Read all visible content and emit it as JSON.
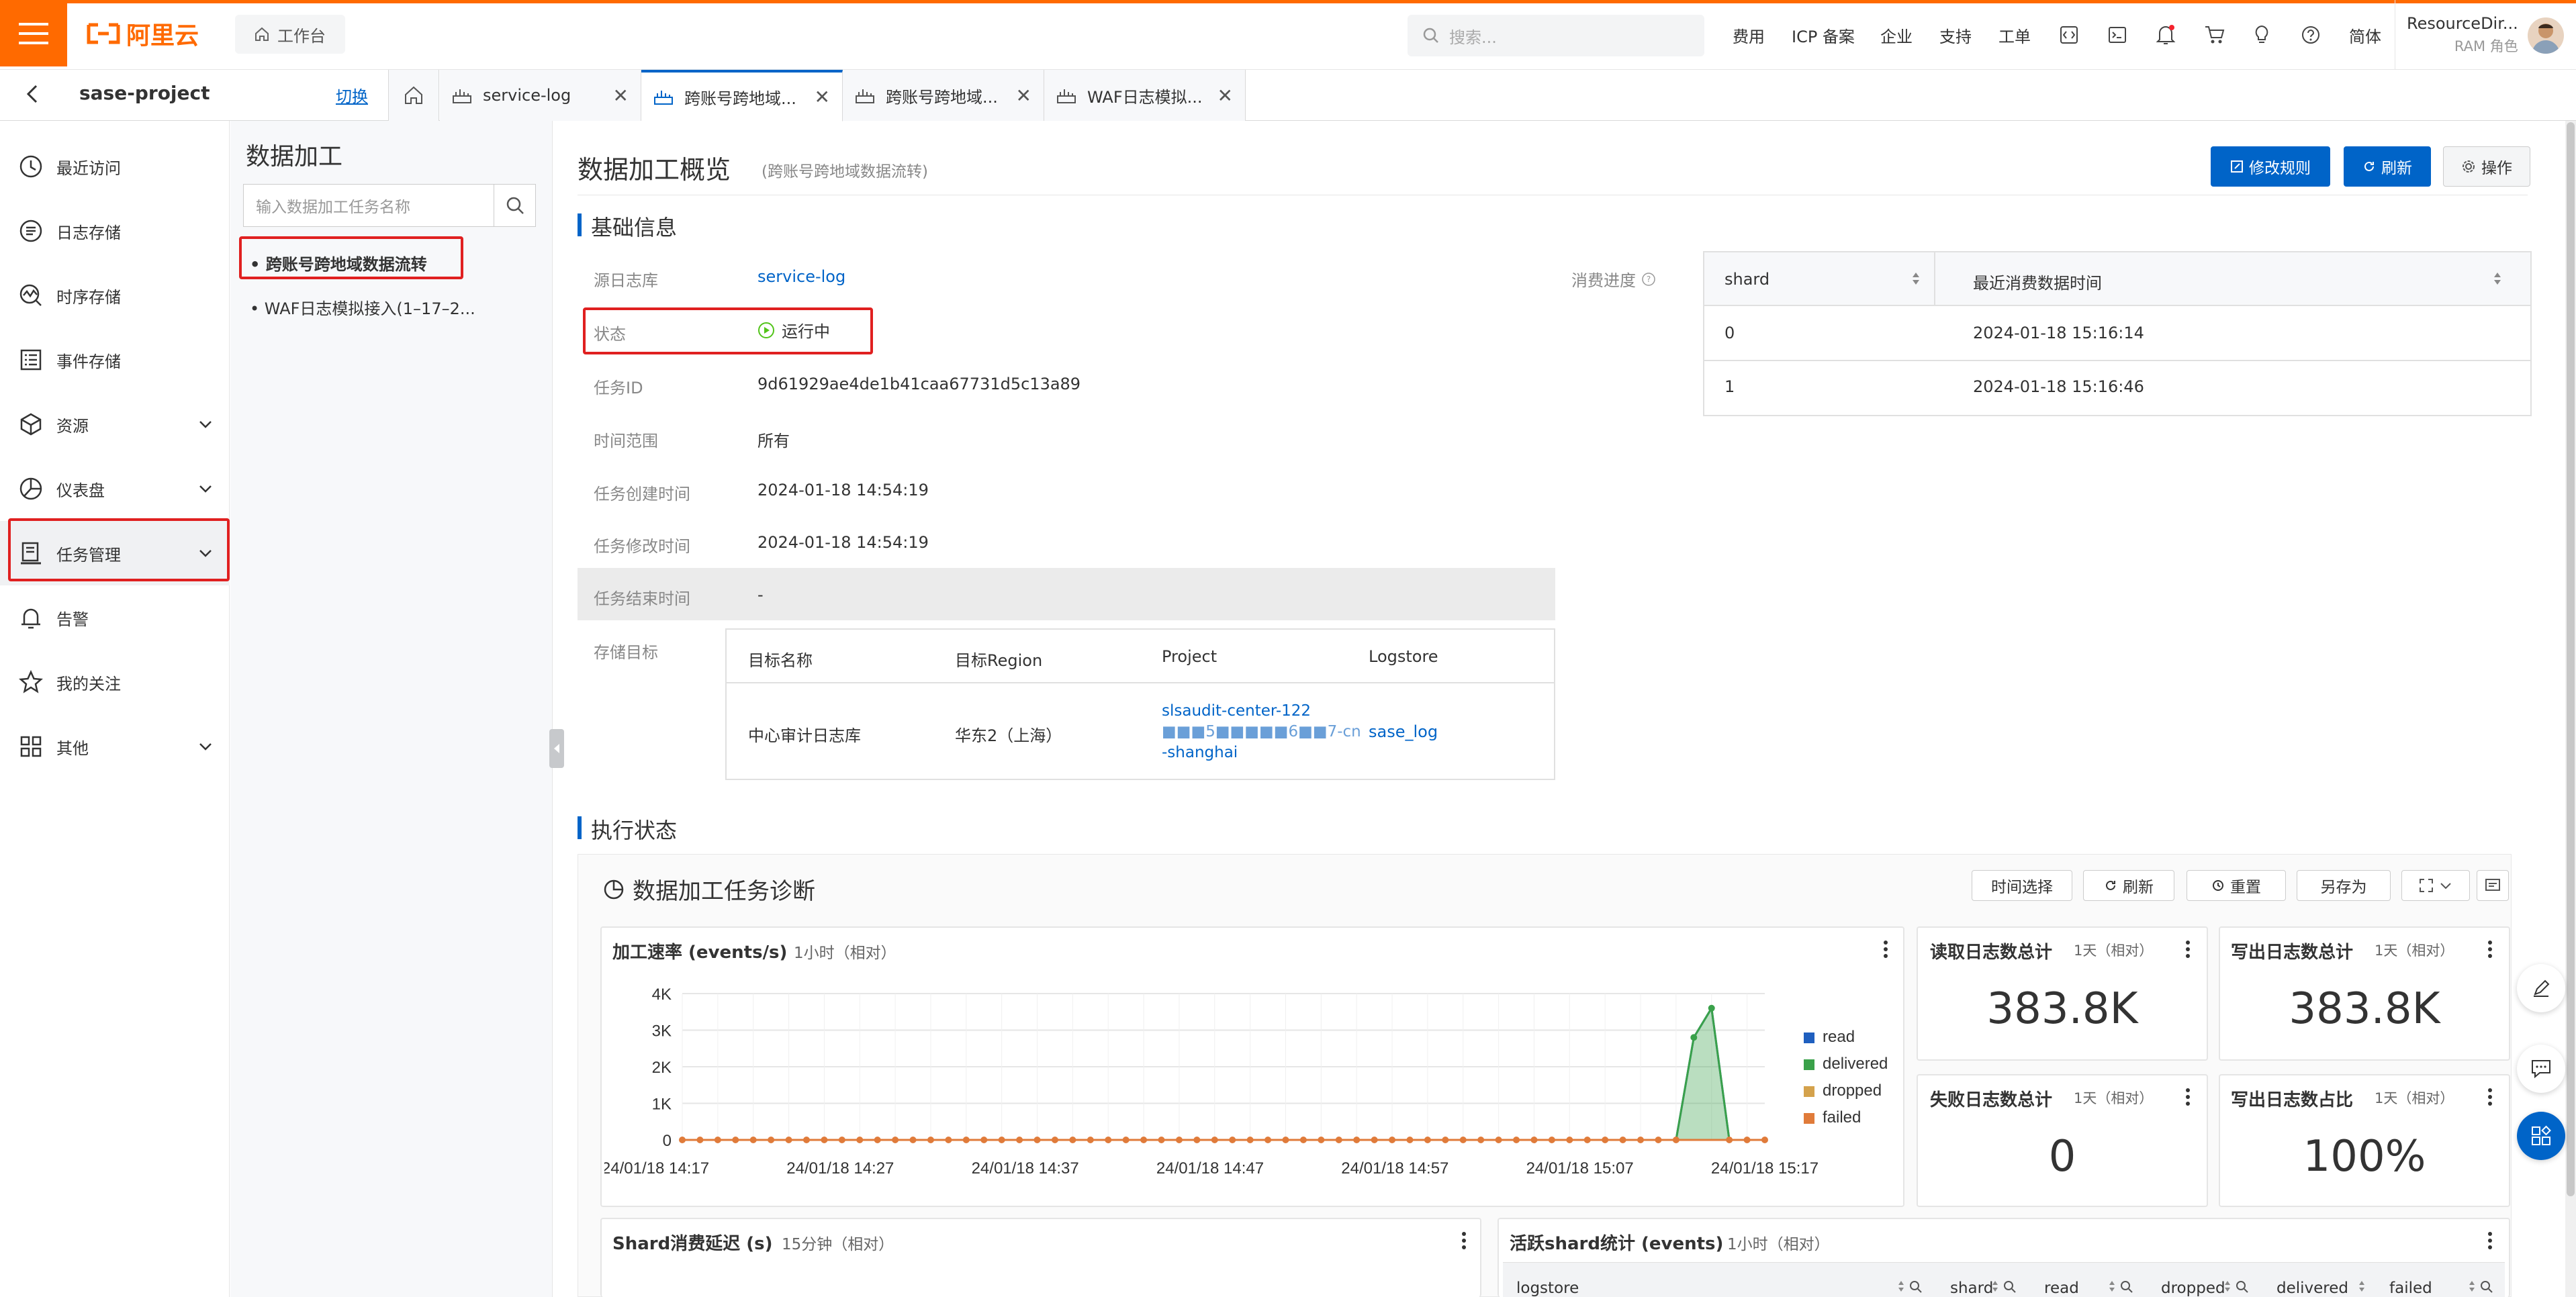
{
  "brand": {
    "logo_text": "阿里云",
    "workbench": "工作台"
  },
  "search": {
    "placeholder": "搜索..."
  },
  "topnav": {
    "fees": "费用",
    "icp": "ICP 备案",
    "enterprise": "企业",
    "support": "支持",
    "ticket": "工单",
    "lang": "简体"
  },
  "user": {
    "name": "ResourceDir...",
    "role": "RAM 角色"
  },
  "project": {
    "name": "sase-project",
    "switch": "切换"
  },
  "tabs": [
    {
      "label": "service-log",
      "active": false
    },
    {
      "label": "跨账号跨地域...",
      "active": true
    },
    {
      "label": "跨账号跨地域...",
      "active": false
    },
    {
      "label": "WAF日志模拟...",
      "active": false
    }
  ],
  "sidebar": {
    "items": [
      {
        "label": "最近访问",
        "icon": "clock-icon"
      },
      {
        "label": "日志存储",
        "icon": "log-store-icon"
      },
      {
        "label": "时序存储",
        "icon": "timeseries-icon"
      },
      {
        "label": "事件存储",
        "icon": "event-icon"
      },
      {
        "label": "资源",
        "icon": "cube-icon"
      },
      {
        "label": "仪表盘",
        "icon": "pie-icon"
      },
      {
        "label": "任务管理",
        "icon": "task-icon"
      },
      {
        "label": "告警",
        "icon": "bell-icon"
      },
      {
        "label": "我的关注",
        "icon": "star-icon"
      },
      {
        "label": "其他",
        "icon": "grid-icon"
      }
    ]
  },
  "panel": {
    "title": "数据加工",
    "search_placeholder": "输入数据加工任务名称",
    "items": [
      "• 跨账号跨地域数据流转",
      "• WAF日志模拟接入(1–17–2..."
    ]
  },
  "page": {
    "title": "数据加工概览",
    "subtitle": "(跨账号跨地域数据流转)",
    "btn_modify": "修改规则",
    "btn_refresh": "刷新",
    "btn_ops": "操作"
  },
  "basic": {
    "section_title": "基础信息",
    "source_label": "源日志库",
    "source_value": "service-log",
    "status_label": "状态",
    "status_value": "运行中",
    "taskid_label": "任务ID",
    "taskid_value": "9d61929ae4de1b41caa67731d5c13a89",
    "range_label": "时间范围",
    "range_value": "所有",
    "created_label": "任务创建时间",
    "created_value": "2024-01-18 14:54:19",
    "modified_label": "任务修改时间",
    "modified_value": "2024-01-18 14:54:19",
    "end_label": "任务结束时间",
    "end_value": "-",
    "target_label": "存储目标",
    "progress_label": "消费进度"
  },
  "target_table": {
    "headers": [
      "目标名称",
      "目标Region",
      "Project",
      "Logstore"
    ],
    "row": {
      "name": "中心审计日志库",
      "region": "华东2（上海）",
      "project_l1": "slsaudit-center-122",
      "project_l2": "■■■5■■■■■6■■7-cn",
      "project_l3": "-shanghai",
      "logstore": "sase_log"
    }
  },
  "shard_table": {
    "headers": [
      "shard",
      "最近消费数据时间"
    ],
    "rows": [
      [
        "0",
        "2024-01-18 15:16:14"
      ],
      [
        "1",
        "2024-01-18 15:16:46"
      ]
    ]
  },
  "exec": {
    "section_title": "执行状态",
    "dash_title": "数据加工任务诊断",
    "btn_time": "时间选择",
    "btn_refresh": "刷新",
    "btn_reset": "重置",
    "btn_saveas": "另存为"
  },
  "speed_card": {
    "title": "加工速率 (events/s)",
    "sub": "1小时（相对）"
  },
  "stats": [
    {
      "title": "读取日志数总计",
      "sub": "1天（相对）",
      "value": "383.8K"
    },
    {
      "title": "写出日志数总计",
      "sub": "1天（相对）",
      "value": "383.8K"
    },
    {
      "title": "失败日志数总计",
      "sub": "1天（相对）",
      "value": "0"
    },
    {
      "title": "写出日志数占比",
      "sub": "1天（相对）",
      "value": "100%"
    }
  ],
  "shard_delay": {
    "title": "Shard消费延迟 (s)",
    "sub": "15分钟（相对）"
  },
  "active_shard": {
    "title": "活跃shard统计 (events)",
    "sub": "1小时（相对）",
    "columns": [
      "logstore",
      "shard",
      "read",
      "dropped",
      "delivered",
      "failed"
    ]
  },
  "chart_data": {
    "type": "line",
    "x": [
      "24/01/18 14:17",
      "24/01/18 14:27",
      "24/01/18 14:37",
      "24/01/18 14:47",
      "24/01/18 14:57",
      "24/01/18 15:07",
      "24/01/18 15:17"
    ],
    "ylim": [
      0,
      4000
    ],
    "yticks": [
      "4K",
      "3K",
      "2K",
      "1K",
      "0"
    ],
    "xticks": [
      "24/01/18 14:17",
      "24/01/18 14:27",
      "24/01/18 14:37",
      "24/01/18 14:47",
      "24/01/18 14:57",
      "24/01/18 15:07",
      "24/01/18 15:17"
    ],
    "series": [
      {
        "name": "read",
        "color": "#1f5fbf",
        "peak": 3600
      },
      {
        "name": "delivered",
        "color": "#3aa14a",
        "peak": 3600
      },
      {
        "name": "dropped",
        "color": "#d4a24c",
        "peak": 0
      },
      {
        "name": "failed",
        "color": "#e07b3a",
        "peak": 0
      }
    ],
    "points_count": 62,
    "spike_points": [
      [
        57,
        2800
      ],
      [
        58,
        3600
      ],
      [
        59,
        0
      ]
    ],
    "legend": "right"
  }
}
